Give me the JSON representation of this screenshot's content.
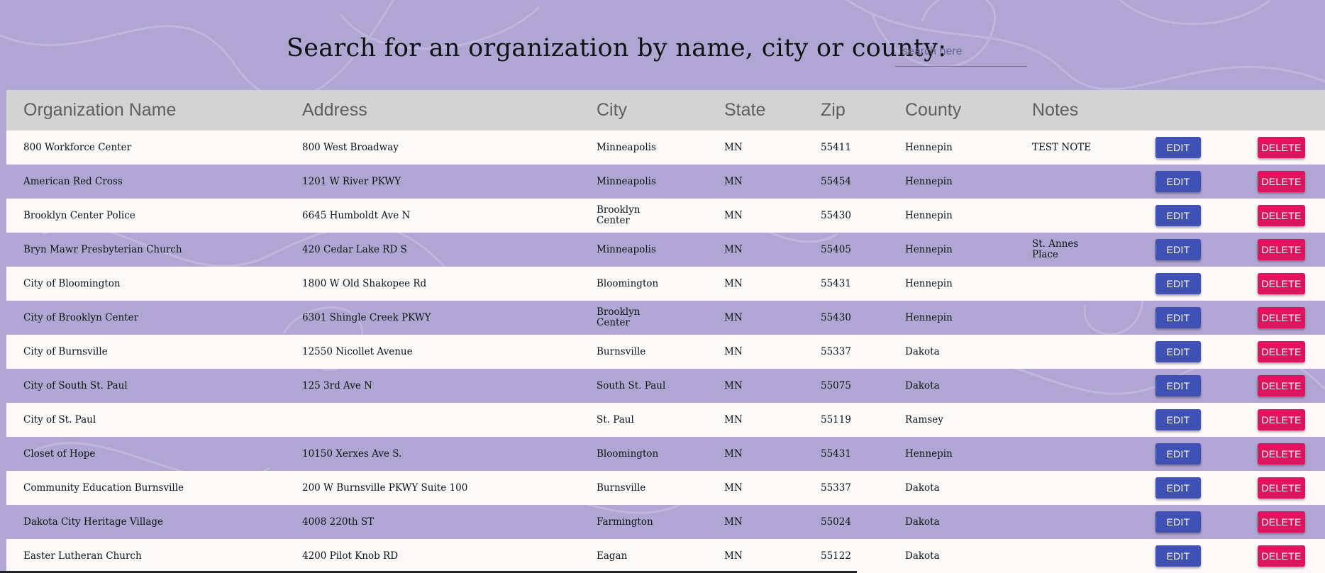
{
  "search": {
    "title": "Search for an organization by name, city or county:",
    "placeholder": "search here",
    "value": ""
  },
  "table": {
    "headers": [
      "Organization Name",
      "Address",
      "City",
      "State",
      "Zip",
      "County",
      "Notes"
    ],
    "edit_label": "EDIT",
    "delete_label": "DELETE",
    "rows": [
      {
        "name": "800 Workforce Center",
        "address": "800 West Broadway",
        "city": "Minneapolis",
        "state": "MN",
        "zip": "55411",
        "county": "Hennepin",
        "notes": "TEST NOTE"
      },
      {
        "name": "American Red Cross",
        "address": "1201 W River PKWY",
        "city": "Minneapolis",
        "state": "MN",
        "zip": "55454",
        "county": "Hennepin",
        "notes": ""
      },
      {
        "name": "Brooklyn Center Police",
        "address": "6645 Humboldt Ave N",
        "city": "Brooklyn Center",
        "state": "MN",
        "zip": "55430",
        "county": "Hennepin",
        "notes": ""
      },
      {
        "name": "Bryn Mawr Presbyterian Church",
        "address": "420 Cedar Lake RD S",
        "city": "Minneapolis",
        "state": "MN",
        "zip": "55405",
        "county": "Hennepin",
        "notes": "St. Annes Place"
      },
      {
        "name": "City of Bloomington",
        "address": "1800 W Old Shakopee Rd",
        "city": "Bloomington",
        "state": "MN",
        "zip": "55431",
        "county": "Hennepin",
        "notes": ""
      },
      {
        "name": "City of Brooklyn Center",
        "address": "6301 Shingle Creek PKWY",
        "city": "Brooklyn Center",
        "state": "MN",
        "zip": "55430",
        "county": "Hennepin",
        "notes": ""
      },
      {
        "name": "City of Burnsville",
        "address": "12550 Nicollet Avenue",
        "city": "Burnsville",
        "state": "MN",
        "zip": "55337",
        "county": "Dakota",
        "notes": ""
      },
      {
        "name": "City of South St. Paul",
        "address": "125 3rd Ave N",
        "city": "South St. Paul",
        "state": "MN",
        "zip": "55075",
        "county": "Dakota",
        "notes": ""
      },
      {
        "name": "City of St. Paul",
        "address": "",
        "city": "St. Paul",
        "state": "MN",
        "zip": "55119",
        "county": "Ramsey",
        "notes": ""
      },
      {
        "name": "Closet of Hope",
        "address": "10150 Xerxes Ave S.",
        "city": "Bloomington",
        "state": "MN",
        "zip": "55431",
        "county": "Hennepin",
        "notes": ""
      },
      {
        "name": "Community Education Burnsville",
        "address": "200 W Burnsville PKWY Suite 100",
        "city": "Burnsville",
        "state": "MN",
        "zip": "55337",
        "county": "Dakota",
        "notes": ""
      },
      {
        "name": "Dakota City Heritage Village",
        "address": "4008 220th ST",
        "city": "Farmington",
        "state": "MN",
        "zip": "55024",
        "county": "Dakota",
        "notes": ""
      },
      {
        "name": "Easter Lutheran Church",
        "address": "4200 Pilot Knob RD",
        "city": "Eagan",
        "state": "MN",
        "zip": "55122",
        "county": "Dakota",
        "notes": ""
      }
    ]
  },
  "colors": {
    "background": "#b0a6d4",
    "header_bg": "#d3d3d3",
    "edit_button": "#3f51b5",
    "delete_button": "#e0135f"
  }
}
